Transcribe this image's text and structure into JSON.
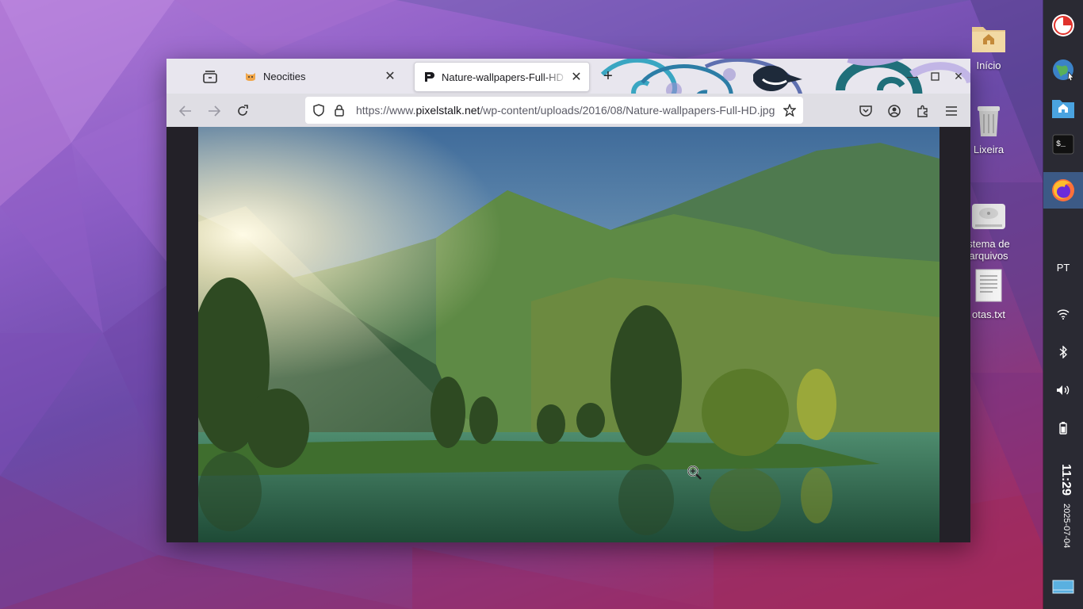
{
  "desktop": {
    "icons": [
      {
        "label": "Início",
        "icon": "home-folder-icon"
      },
      {
        "label": "Lixeira",
        "icon": "trash-icon"
      },
      {
        "label": "stema de\narquivos",
        "icon": "drive-icon"
      },
      {
        "label": "otas.txt",
        "icon": "text-file-icon"
      }
    ]
  },
  "browser": {
    "tabs": [
      {
        "title": "Neocities",
        "icon": "neocities-cat-icon",
        "active": false
      },
      {
        "title": "Nature-wallpapers-Full-HD",
        "icon": "pixelstalk-icon",
        "active": true
      }
    ],
    "url": {
      "prefix": "https://www.",
      "domain": "pixelstalk.net",
      "path": "/wp-content/uploads/2016/08/Nature-wallpapers-Full-HD.jpg"
    },
    "content": {
      "image_alt": "Lake with trees and mountains"
    }
  },
  "dock": {
    "language": "PT",
    "time": "11:29",
    "date": "2025-07-04"
  },
  "colors": {
    "dock_bg": "#2a2a33",
    "dock_active": "#3c5a86",
    "firefox_orange": "#ff7139"
  }
}
